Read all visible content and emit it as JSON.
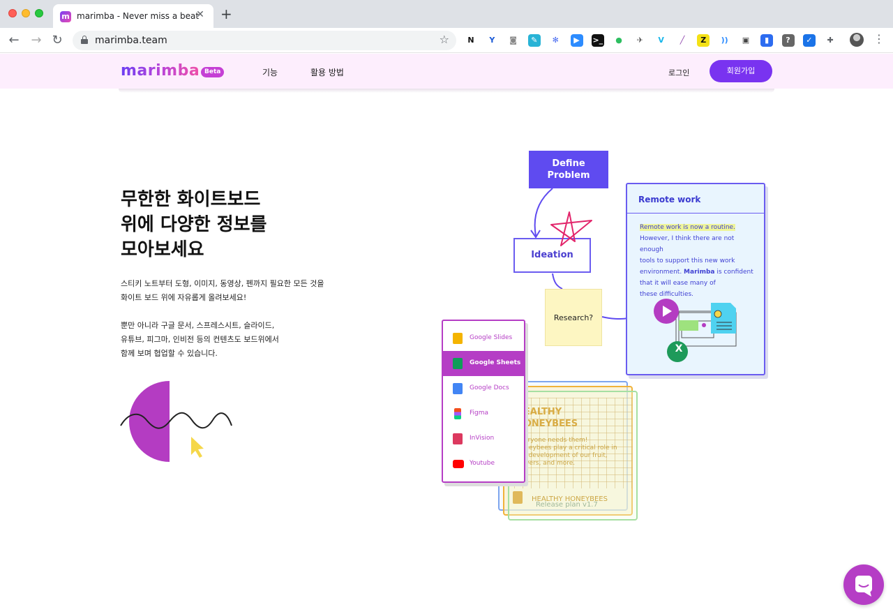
{
  "browser": {
    "tab_title": "marimba - Never miss a beat",
    "tab_favicon": "m",
    "close_glyph": "✕",
    "new_tab_glyph": "+",
    "back_glyph": "←",
    "forward_glyph": "→",
    "reload_glyph": "↻",
    "url": "marimba.team",
    "bookmark_glyph": "☆",
    "menu_glyph": "⋮",
    "extensions": [
      {
        "name": "notion-icon",
        "glyph": "N",
        "bg": "#ffffff",
        "fg": "#111111"
      },
      {
        "name": "vectorly-icon",
        "glyph": "Y",
        "bg": "#ffffff",
        "fg": "#1b5ad6"
      },
      {
        "name": "camera-icon",
        "glyph": "◙",
        "bg": "#ffffff",
        "fg": "#888888"
      },
      {
        "name": "pen-extension-icon",
        "glyph": "✎",
        "bg": "#28b3d6",
        "fg": "#ffffff"
      },
      {
        "name": "snowflake-icon",
        "glyph": "✻",
        "bg": "#ffffff",
        "fg": "#4a6cf0"
      },
      {
        "name": "zoom-icon",
        "glyph": "▶",
        "bg": "#2d8cff",
        "fg": "#ffffff"
      },
      {
        "name": "terminal-icon",
        "glyph": ">_",
        "bg": "#111111",
        "fg": "#ffffff"
      },
      {
        "name": "evernote-icon",
        "glyph": "●",
        "bg": "#ffffff",
        "fg": "#2dbe60"
      },
      {
        "name": "bird-icon",
        "glyph": "✈",
        "bg": "#ffffff",
        "fg": "#555555"
      },
      {
        "name": "vimeo-icon",
        "glyph": "V",
        "bg": "#ffffff",
        "fg": "#1ab7ea"
      },
      {
        "name": "feather-icon",
        "glyph": "╱",
        "bg": "#ffffff",
        "fg": "#8e44ad"
      },
      {
        "name": "z-extension-icon",
        "glyph": "Z",
        "bg": "#f4e116",
        "fg": "#111111"
      },
      {
        "name": "wireless-icon",
        "glyph": "))",
        "bg": "#ffffff",
        "fg": "#2d8cff"
      },
      {
        "name": "media-icon",
        "glyph": "▣",
        "bg": "#ffffff",
        "fg": "#444444"
      },
      {
        "name": "bookmark-extension-icon",
        "glyph": "▮",
        "bg": "#2d6cf0",
        "fg": "#ffffff"
      },
      {
        "name": "help-icon",
        "glyph": "?",
        "bg": "#666666",
        "fg": "#ffffff"
      },
      {
        "name": "check-icon",
        "glyph": "✓",
        "bg": "#1a73e8",
        "fg": "#ffffff"
      },
      {
        "name": "puzzle-icon",
        "glyph": "✚",
        "bg": "#ffffff",
        "fg": "#5f6368"
      }
    ]
  },
  "site": {
    "logo": "marimba",
    "beta": "Beta",
    "nav": [
      "기능",
      "활용 방법"
    ],
    "login": "로그인",
    "signup": "회원가입"
  },
  "hero": {
    "headline": [
      "무한한 화이트보드",
      "위에 다양한 정보를",
      "모아보세요"
    ],
    "paragraph1": [
      "스티키 노트부터 도형, 이미지, 동영상, 펜까지 필요한 모든 것을",
      "화이트 보드 위에 자유롭게 올려보세요!"
    ],
    "paragraph2": [
      "뿐만 아니라 구글 문서, 스프레스시트, 슬라이드,",
      "유튜브, 피그마, 인비전 등의 컨텐츠도 보드위에서",
      "함께 보며 협업할 수 있습니다."
    ]
  },
  "illustration": {
    "define": [
      "Define",
      "Problem"
    ],
    "ideation": "Ideation",
    "research": "Research?",
    "remote_title": "Remote work",
    "remote_highlight": "Remote work is now a routine.",
    "remote_lines": [
      "However, I think there are not enough",
      "tools to support this new work"
    ],
    "remote_line_prefix": "environment. ",
    "remote_bold": "Marimba",
    "remote_line_suffix": " is confident",
    "remote_lines_end": [
      "that it will ease many of",
      "these difficulties."
    ],
    "x_badge": "X",
    "apps": [
      {
        "label": "Google Slides",
        "color": "#f4b400",
        "active": false
      },
      {
        "label": "Google Sheets",
        "color": "#0f9d58",
        "active": true
      },
      {
        "label": "Google Docs",
        "color": "#4285f4",
        "active": false
      },
      {
        "label": "Figma",
        "color": "#f24e1e",
        "active": false
      },
      {
        "label": "InVision",
        "color": "#dc395f",
        "active": false
      },
      {
        "label": "Youtube",
        "color": "#ff0000",
        "active": false
      }
    ],
    "honey_title": [
      "HEALTHY",
      "HONEYBEES"
    ],
    "honey_text": [
      "Everyone needs them!",
      "Honeybees play a critical role in",
      "the development of our fruit,",
      "flowers, and more."
    ],
    "honey_footer": "HEALTHY HONEYBEES",
    "release": "Release plan v1.7"
  }
}
